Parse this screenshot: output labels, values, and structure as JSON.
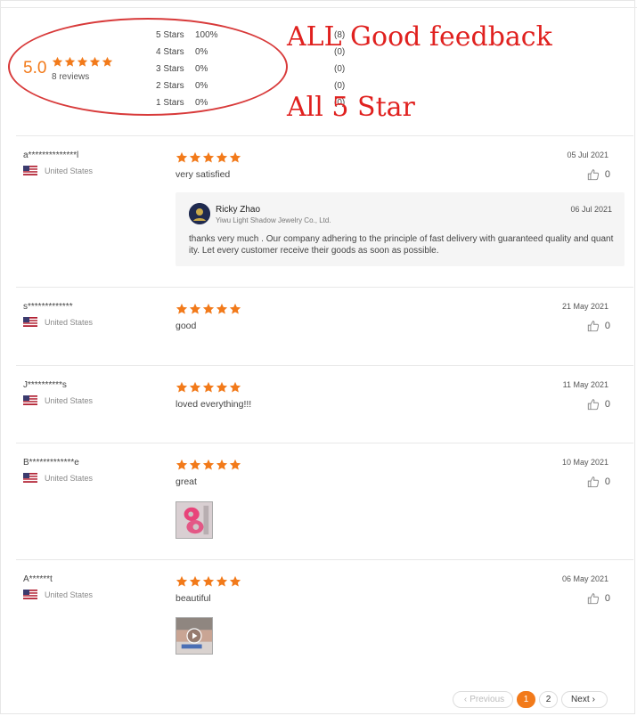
{
  "summary": {
    "average": "5.0",
    "rating_stars": 5,
    "review_count": "8 reviews",
    "distribution": [
      {
        "label": "5  Stars",
        "percent": "100%",
        "count": "(8)"
      },
      {
        "label": "4  Stars",
        "percent": "0%",
        "count": "(0)"
      },
      {
        "label": "3  Stars",
        "percent": "0%",
        "count": "(0)"
      },
      {
        "label": "2  Stars",
        "percent": "0%",
        "count": "(0)"
      },
      {
        "label": "1  Stars",
        "percent": "0%",
        "count": "(0)"
      }
    ],
    "annotation_1": "ALL Good feedback",
    "annotation_2": "All 5 Star"
  },
  "colors": {
    "star": "#f27a1a",
    "annotation": "#e0211f",
    "accent": "#f27a1a"
  },
  "reviews": [
    {
      "reviewer": "a**************l",
      "country": "United States",
      "rating": 5,
      "text": "very satisfied",
      "date": "05 Jul 2021",
      "likes": "0",
      "reply": {
        "name": "Ricky Zhao",
        "company": "Yiwu Light Shadow Jewelry Co., Ltd.",
        "date": "06 Jul 2021",
        "text": "thanks very much . Our company adhering to the principle of fast delivery with guaranteed quality and quantity. Let every customer receive their goods as soon as possible."
      }
    },
    {
      "reviewer": "s*************",
      "country": "United States",
      "rating": 5,
      "text": "good",
      "date": "21 May 2021",
      "likes": "0"
    },
    {
      "reviewer": "J**********s",
      "country": "United States",
      "rating": 5,
      "text": "loved everything!!!",
      "date": "11 May 2021",
      "likes": "0"
    },
    {
      "reviewer": "B*************e",
      "country": "United States",
      "rating": 5,
      "text": "great",
      "date": "10 May 2021",
      "likes": "0",
      "photo": "pink-item-photo"
    },
    {
      "reviewer": "A******t",
      "country": "United States",
      "rating": 5,
      "text": "beautiful",
      "date": "06 May 2021",
      "likes": "0",
      "photo": "video-thumbnail"
    }
  ],
  "pagination": {
    "prev": "Previous",
    "pages": [
      "1",
      "2"
    ],
    "active": "1",
    "next": "Next"
  }
}
